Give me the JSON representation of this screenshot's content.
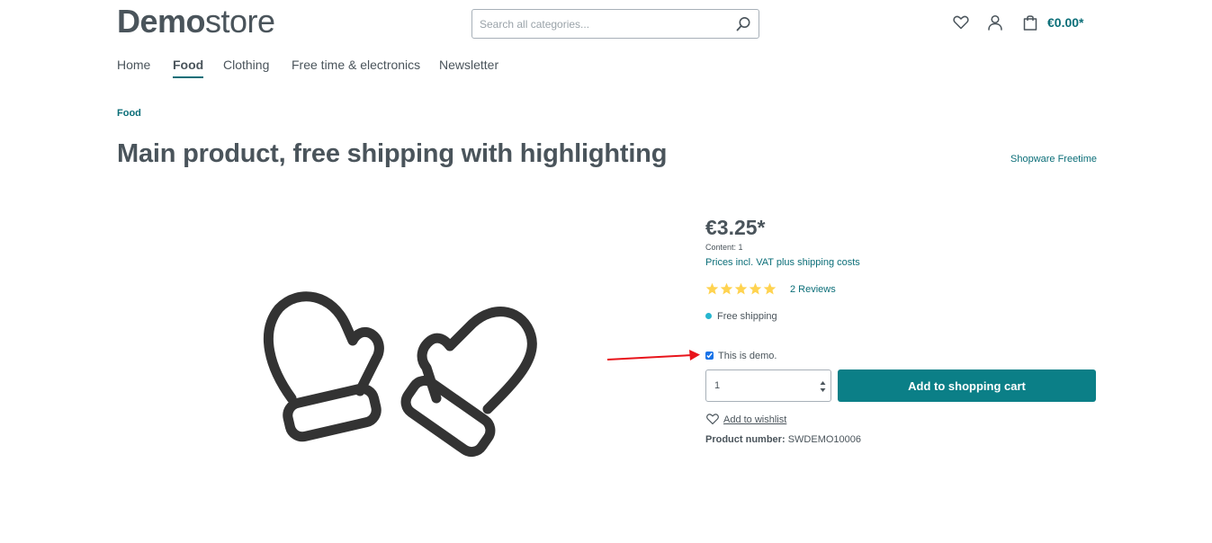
{
  "header": {
    "logo_bold": "Demo",
    "logo_light": "store",
    "search_placeholder": "Search all categories...",
    "cart_total": "€0.00*"
  },
  "nav": {
    "items": [
      {
        "label": "Home",
        "active": false
      },
      {
        "label": "Food",
        "active": true
      },
      {
        "label": "Clothing",
        "active": false
      },
      {
        "label": "Free time & electronics",
        "active": false
      },
      {
        "label": "Newsletter",
        "active": false
      }
    ]
  },
  "breadcrumb": "Food",
  "product": {
    "title": "Main product, free shipping with highlighting",
    "manufacturer": "Shopware Freetime",
    "price": "€3.25*",
    "content": "Content: 1",
    "tax_text": "Prices incl. VAT plus shipping costs",
    "rating": 5,
    "reviews_label": "2 Reviews",
    "delivery": "Free shipping",
    "demo_checkbox_label": "This is demo.",
    "demo_checked": true,
    "quantity": "1",
    "add_to_cart_label": "Add to shopping cart",
    "wishlist_label": "Add to wishlist",
    "product_number_label": "Product number:",
    "product_number": "SWDEMO10006",
    "image_icon": "mittens-icon"
  },
  "colors": {
    "accent": "#0b6e78",
    "button": "#0b7f87",
    "star": "#ffd350",
    "delivery_dot": "#26b6cf",
    "annotation_arrow": "#e8141b"
  }
}
